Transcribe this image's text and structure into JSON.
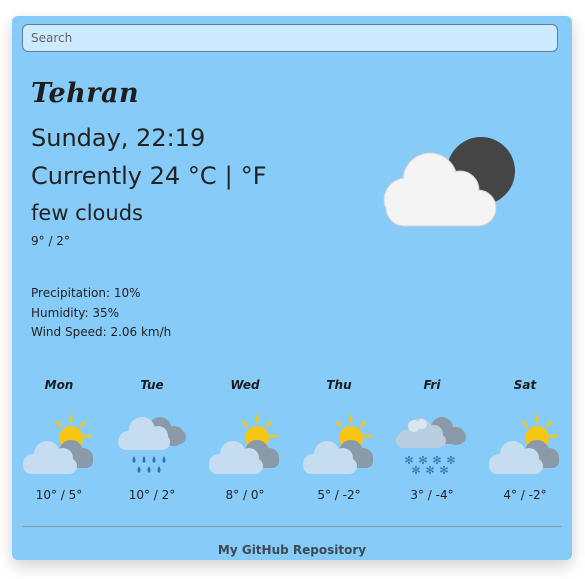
{
  "search": {
    "placeholder": "Search",
    "value": ""
  },
  "current": {
    "city": "Tehran",
    "datetime": "Sunday, 22:19",
    "prefix": "Currently",
    "temperature": "24",
    "unit_c": "°C",
    "unit_separator": "|",
    "unit_f": "°F",
    "description": "few clouds",
    "minmax": "9° / 2°",
    "icon": "cloud-over-moon-icon",
    "precipitation": "Precipitation: 10%",
    "humidity": "Humidity: 35%",
    "wind": "Wind Speed: 2.06 km/h"
  },
  "forecast": [
    {
      "day": "Mon",
      "temps": "10° / 5°",
      "icon": "partly-cloudy-sun-icon"
    },
    {
      "day": "Tue",
      "temps": "10° / 2°",
      "icon": "rain-cloud-icon"
    },
    {
      "day": "Wed",
      "temps": "8° / 0°",
      "icon": "partly-cloudy-sun-icon"
    },
    {
      "day": "Thu",
      "temps": "5° / -2°",
      "icon": "partly-cloudy-sun-icon"
    },
    {
      "day": "Fri",
      "temps": "3° / -4°",
      "icon": "snow-cloud-icon"
    },
    {
      "day": "Sat",
      "temps": "4° / -2°",
      "icon": "partly-cloudy-sun-icon"
    }
  ],
  "footer": {
    "link_label": "My GitHub Repository"
  },
  "colors": {
    "card": "#87cbf8",
    "search_bg": "#cdeafe",
    "text": "#222222",
    "sun": "#f6c614",
    "moon": "#454545",
    "cloud": "#f4f4f4"
  }
}
